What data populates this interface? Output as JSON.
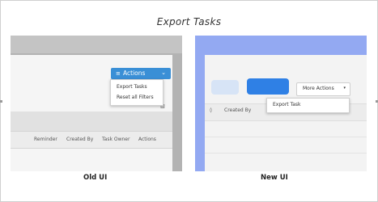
{
  "title": "Export Tasks",
  "old_ui": {
    "caption": "Old UI",
    "actions_button": {
      "label": "Actions",
      "icon": "list-icon",
      "chevron": "chevron-down-icon",
      "color": "#3a8fd6"
    },
    "menu_items": [
      "Export Tasks",
      "Reset all Filters"
    ],
    "columns": [
      "Reminder",
      "Created By",
      "Task Owner",
      "Actions"
    ]
  },
  "new_ui": {
    "caption": "New UI",
    "more_actions_button": {
      "label": "More Actions",
      "chevron": "caret-down-icon"
    },
    "menu_items": [
      "Export Task"
    ],
    "columns": [
      "Created By"
    ],
    "accent_color": "#2f80e5",
    "background_color": "#93a9f2"
  },
  "icons": {
    "list": "≡",
    "chevron_down": "⌄",
    "caret_down": "▾",
    "grid": "▥",
    "sort": "◊"
  }
}
